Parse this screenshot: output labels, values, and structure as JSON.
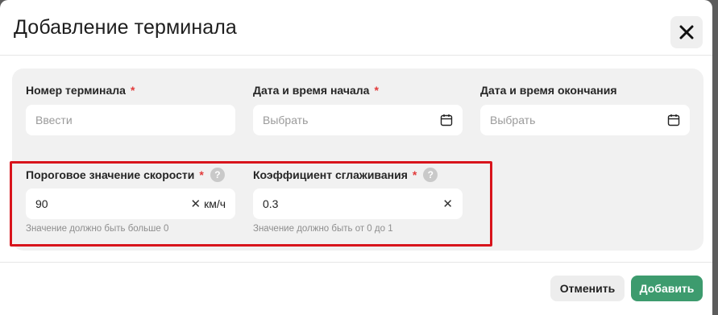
{
  "dialog": {
    "title": "Добавление терминала",
    "close_icon": "close-icon"
  },
  "fields": {
    "terminal_number": {
      "label": "Номер терминала",
      "required_mark": "*",
      "placeholder": "Ввести",
      "value": ""
    },
    "start_datetime": {
      "label": "Дата и время начала",
      "required_mark": "*",
      "placeholder": "Выбрать",
      "icon": "calendar-icon"
    },
    "end_datetime": {
      "label": "Дата и время окончания",
      "placeholder": "Выбрать",
      "icon": "calendar-icon"
    },
    "speed_threshold": {
      "label": "Пороговое значение скорости",
      "required_mark": "*",
      "help": "?",
      "value": "90",
      "clear": "✕",
      "unit": "км/ч",
      "hint": "Значение должно быть больше 0"
    },
    "smoothing": {
      "label": "Коэффициент сглаживания",
      "required_mark": "*",
      "help": "?",
      "value": "0.3",
      "clear": "✕",
      "hint": "Значение должно быть от 0 до 1"
    }
  },
  "footer": {
    "cancel_label": "Отменить",
    "add_label": "Добавить"
  },
  "colors": {
    "accent": "#3d9b6e",
    "required": "#e23b3b",
    "highlight": "#d8141c"
  }
}
